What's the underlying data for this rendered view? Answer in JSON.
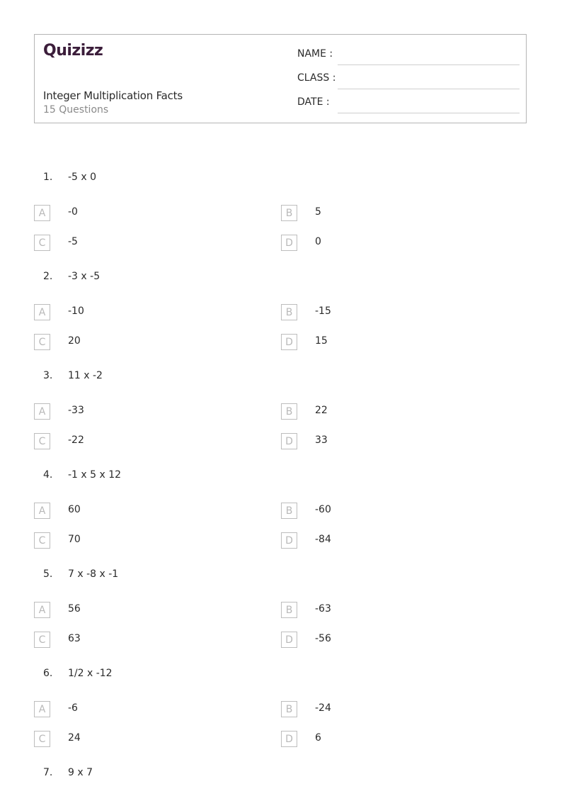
{
  "header": {
    "logo": "Quizizz",
    "title": "Integer Multiplication Facts",
    "subtitle": "15 Questions",
    "fields": [
      {
        "label": "NAME :"
      },
      {
        "label": "CLASS :"
      },
      {
        "label": "DATE  :"
      }
    ]
  },
  "questions": [
    {
      "number": "1.",
      "text": "-5 x 0",
      "options": [
        {
          "letter": "A",
          "text": "-0"
        },
        {
          "letter": "B",
          "text": "5"
        },
        {
          "letter": "C",
          "text": "-5"
        },
        {
          "letter": "D",
          "text": "0"
        }
      ]
    },
    {
      "number": "2.",
      "text": "-3 x -5",
      "options": [
        {
          "letter": "A",
          "text": "-10"
        },
        {
          "letter": "B",
          "text": "-15"
        },
        {
          "letter": "C",
          "text": "20"
        },
        {
          "letter": "D",
          "text": "15"
        }
      ]
    },
    {
      "number": "3.",
      "text": "11 x -2",
      "options": [
        {
          "letter": "A",
          "text": "-33"
        },
        {
          "letter": "B",
          "text": "22"
        },
        {
          "letter": "C",
          "text": "-22"
        },
        {
          "letter": "D",
          "text": "33"
        }
      ]
    },
    {
      "number": "4.",
      "text": "-1 x 5 x 12",
      "options": [
        {
          "letter": "A",
          "text": "60"
        },
        {
          "letter": "B",
          "text": "-60"
        },
        {
          "letter": "C",
          "text": "70"
        },
        {
          "letter": "D",
          "text": "-84"
        }
      ]
    },
    {
      "number": "5.",
      "text": "7 x -8 x -1",
      "options": [
        {
          "letter": "A",
          "text": "56"
        },
        {
          "letter": "B",
          "text": "-63"
        },
        {
          "letter": "C",
          "text": "63"
        },
        {
          "letter": "D",
          "text": "-56"
        }
      ]
    },
    {
      "number": "6.",
      "text": "1/2 x -12",
      "options": [
        {
          "letter": "A",
          "text": "-6"
        },
        {
          "letter": "B",
          "text": "-24"
        },
        {
          "letter": "C",
          "text": "24"
        },
        {
          "letter": "D",
          "text": "6"
        }
      ]
    },
    {
      "number": "7.",
      "text": "9 x 7",
      "options": []
    }
  ]
}
